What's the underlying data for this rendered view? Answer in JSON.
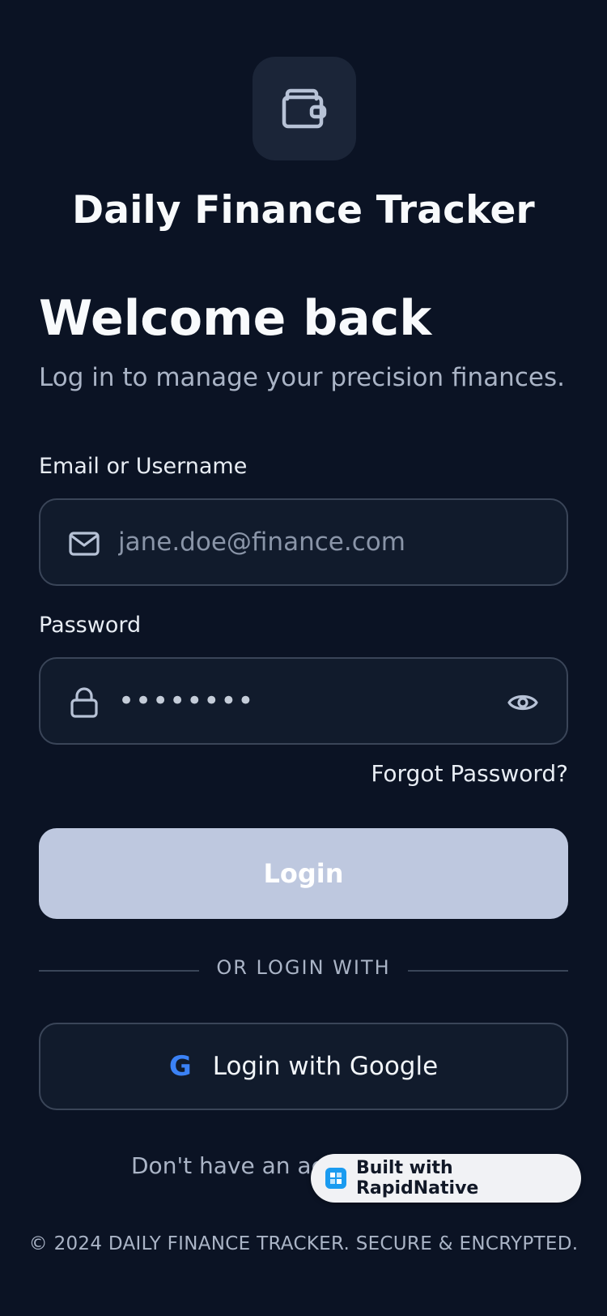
{
  "app": {
    "title": "Daily Finance Tracker",
    "logo_icon": "wallet-icon"
  },
  "heading": {
    "welcome": "Welcome back",
    "subtitle": "Log in to manage your precision finances."
  },
  "form": {
    "email_label": "Email or Username",
    "email_placeholder": "jane.doe@finance.com",
    "email_icon": "mail-icon",
    "password_label": "Password",
    "password_value": "••••••••",
    "password_icon": "lock-icon",
    "show_password_icon": "eye-icon",
    "forgot_password": "Forgot Password?",
    "login_button": "Login"
  },
  "divider": {
    "text": "OR LOGIN WITH"
  },
  "social": {
    "google_glyph": "G",
    "google_label": "Login with Google"
  },
  "signup": {
    "text": "Don't have an acc"
  },
  "badge": {
    "text": "Built with RapidNative"
  },
  "footer": {
    "text": "© 2024 DAILY FINANCE TRACKER. SECURE & ENCRYPTED."
  },
  "colors": {
    "background": "#0b1324",
    "field_bg": "#111b2c",
    "field_border": "#3a4558",
    "login_button": "#bec8df",
    "google_blue": "#3b82f6",
    "muted_text": "#aab4c6"
  }
}
